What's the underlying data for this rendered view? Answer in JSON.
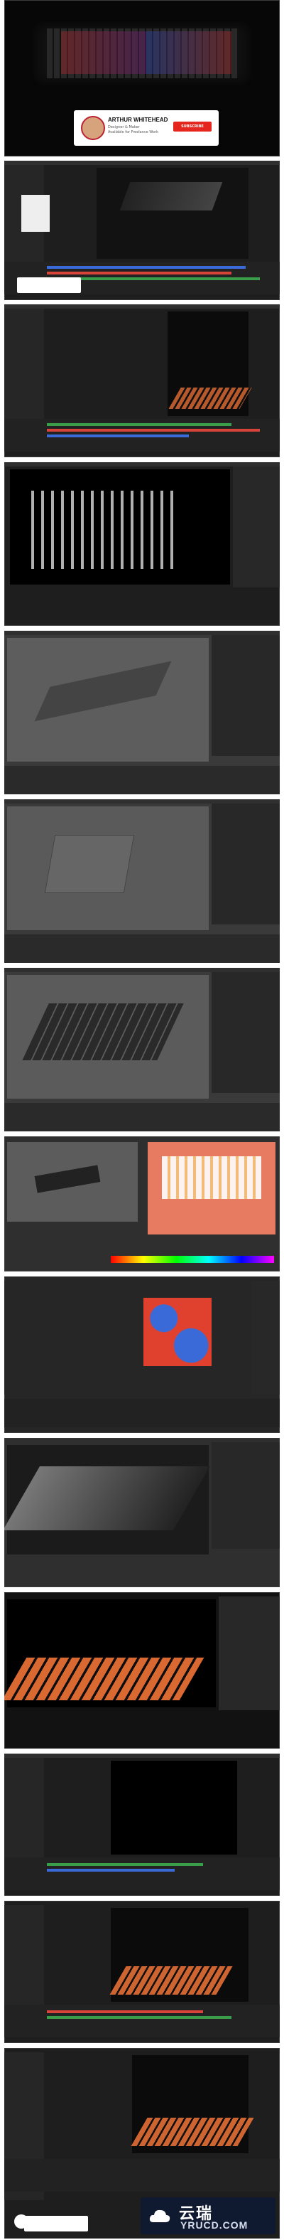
{
  "title_card": {
    "name": "ARTHUR WHITEHEAD",
    "role": "Designer & Maker",
    "subscribers": "Available for Freelance Work",
    "subscribe_label": "SUBSCRIBE"
  },
  "watermark": {
    "cn": "云瑞",
    "en": "YRUCD.COM"
  },
  "colors": {
    "app_bg": "#1e1e1e",
    "accent_red": "#e5261f",
    "track_blue": "#3a6ad8",
    "track_green": "#3a9d4a",
    "track_red": "#d8443a",
    "render_orange": "#ff7a3a"
  }
}
